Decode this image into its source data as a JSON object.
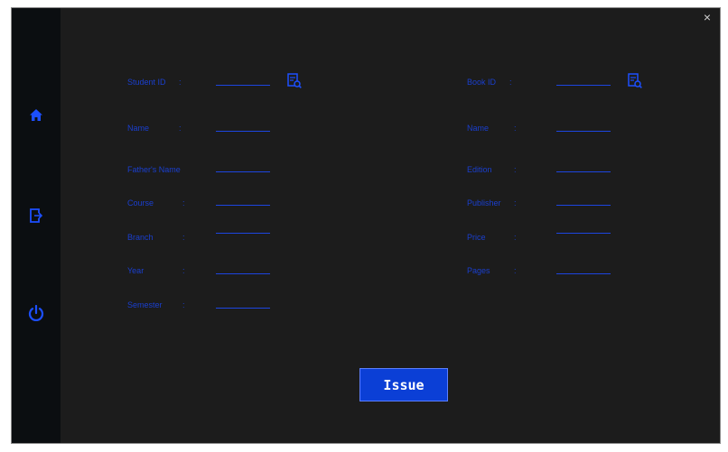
{
  "window": {
    "close_label": "×"
  },
  "sidebar": {
    "items": [
      {
        "icon": "home-icon"
      },
      {
        "icon": "logout-icon"
      },
      {
        "icon": "power-icon"
      }
    ]
  },
  "student": {
    "id_label": "Student ID",
    "fields": [
      {
        "label": "Name"
      },
      {
        "label": "Father's Name"
      },
      {
        "label": "Course"
      },
      {
        "label": "Branch"
      },
      {
        "label": "Year"
      },
      {
        "label": "Semester"
      }
    ]
  },
  "book": {
    "id_label": "Book ID",
    "fields": [
      {
        "label": "Name"
      },
      {
        "label": "Edition"
      },
      {
        "label": "Publisher"
      },
      {
        "label": "Price"
      },
      {
        "label": "Pages"
      }
    ]
  },
  "colon": ":",
  "issue_label": "Issue",
  "colors": {
    "accent": "#0b3fd6",
    "label": "#1a3fcf",
    "background": "#1c1c1c",
    "sidebar": "#0b0e11"
  }
}
